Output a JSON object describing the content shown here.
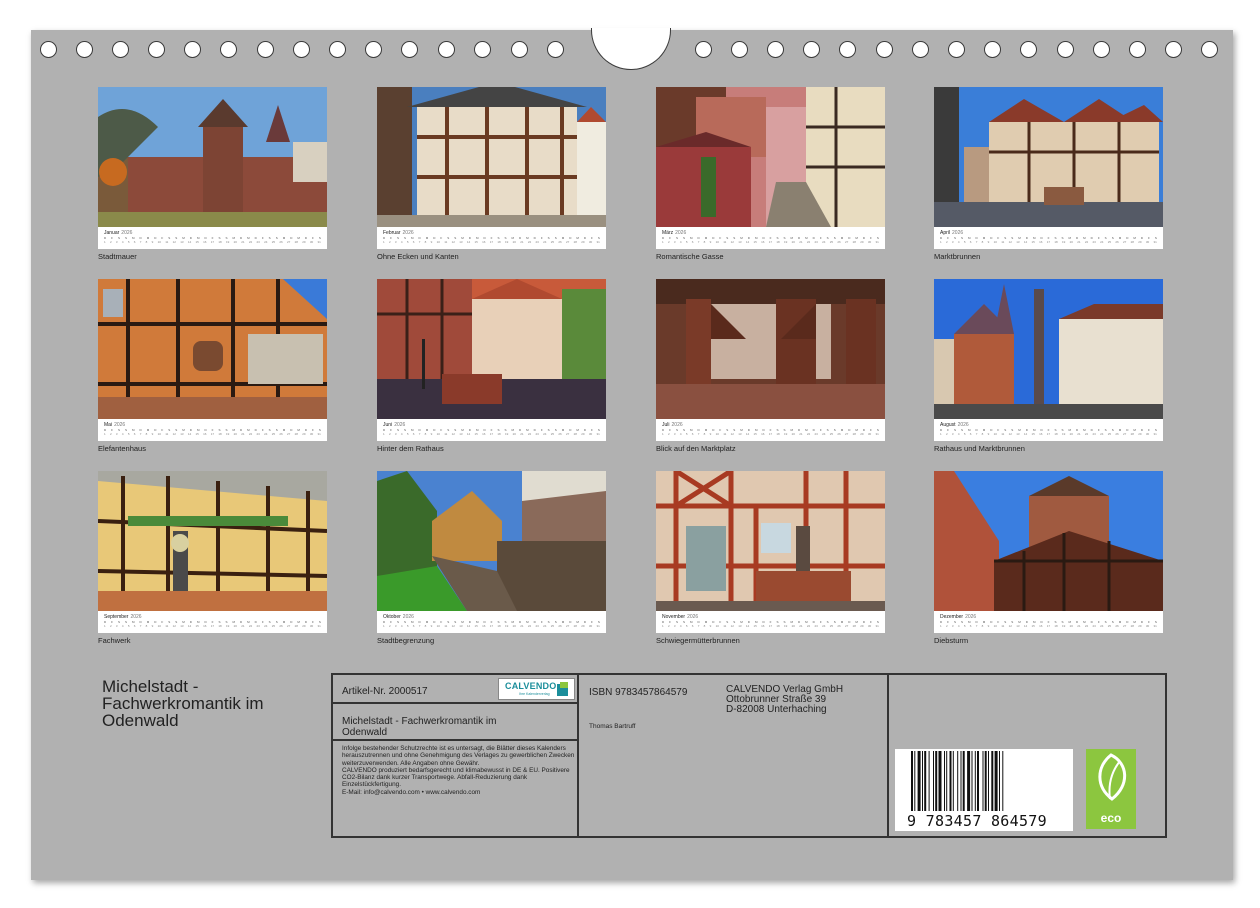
{
  "months": [
    {
      "name": "Januar",
      "year": "2026",
      "caption": "Stadtmauer"
    },
    {
      "name": "Februar",
      "year": "2026",
      "caption": "Ohne Ecken und Kanten"
    },
    {
      "name": "März",
      "year": "2026",
      "caption": "Romantische Gasse"
    },
    {
      "name": "April",
      "year": "2026",
      "caption": "Marktbrunnen"
    },
    {
      "name": "Mai",
      "year": "2026",
      "caption": "Elefantenhaus"
    },
    {
      "name": "Juni",
      "year": "2026",
      "caption": "Hinter dem Rathaus"
    },
    {
      "name": "Juli",
      "year": "2026",
      "caption": "Blick auf den Marktplatz"
    },
    {
      "name": "August",
      "year": "2026",
      "caption": "Rathaus und Marktbrunnen"
    },
    {
      "name": "September",
      "year": "2026",
      "caption": "Fachwerk"
    },
    {
      "name": "Oktober",
      "year": "2026",
      "caption": "Stadtbegrenzung"
    },
    {
      "name": "November",
      "year": "2026",
      "caption": "Schwiegermütterbrunnen"
    },
    {
      "name": "Dezember",
      "year": "2026",
      "caption": "Diebsturm"
    }
  ],
  "calendar": {
    "weekday_letters": [
      "D",
      "F",
      "S",
      "S",
      "M",
      "D",
      "M",
      "D",
      "F",
      "S",
      "S",
      "M",
      "D",
      "M",
      "D",
      "F",
      "S",
      "S",
      "M",
      "D",
      "M",
      "D",
      "F",
      "S",
      "S",
      "M",
      "D",
      "M",
      "D",
      "F",
      "S"
    ],
    "dates": [
      "1",
      "2",
      "3",
      "4",
      "5",
      "6",
      "7",
      "8",
      "9",
      "10",
      "11",
      "12",
      "13",
      "14",
      "15",
      "16",
      "17",
      "18",
      "19",
      "20",
      "21",
      "22",
      "23",
      "24",
      "25",
      "26",
      "27",
      "28",
      "29",
      "30",
      "31"
    ]
  },
  "footer": {
    "title": "Michelstadt - Fachwerkromantik im Odenwald",
    "article": "Artikel-Nr. 2000517",
    "logo": {
      "name": "CALVENDO",
      "tagline": "Ihre Kalenderverlag",
      "color": "#1b8e9b"
    },
    "subtitle": "Michelstadt - Fachwerkromantik im Odenwald",
    "legal": [
      "Infolge bestehender Schutzrechte ist es untersagt, die Blätter dieses Kalenders herauszutrennen und ohne Genehmigung des Verlages zu gewerblichen Zwecken weiterzuverwenden. Alle Angaben ohne Gewähr.",
      "CALVENDO produziert bedarfsgerecht und klimabewusst in DE & EU. Positivere CO2-Bilanz dank kurzer Transportwege. Abfall-Reduzierung dank Einzelstückfertigung.",
      "E-Mail: info@calvendo.com • www.calvendo.com"
    ],
    "isbn": "ISBN 9783457864579",
    "author": "Thomas Bartruff",
    "publisher": [
      "CALVENDO Verlag GmbH",
      "Ottobrunner Straße 39",
      "D-82008 Unterhaching"
    ],
    "barcode_number": "9  783457  864579",
    "eco_label": "eco",
    "eco_color": "#8cc63f"
  }
}
